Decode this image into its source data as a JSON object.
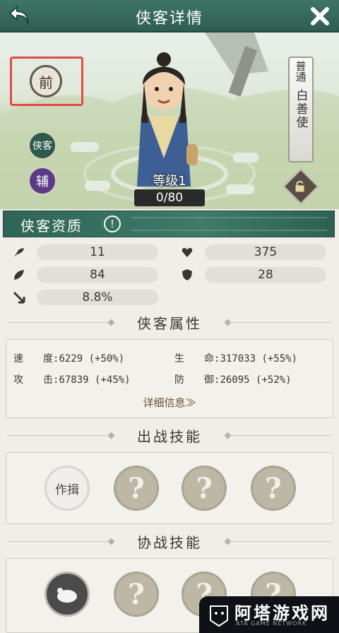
{
  "header": {
    "title": "侠客详情"
  },
  "hero": {
    "position_badge": "前",
    "role_badges": [
      "侠客",
      "辅"
    ],
    "level_text": "等级1",
    "exp_text": "0/80",
    "rarity": "普通",
    "type": "白善使"
  },
  "quality": {
    "title": "侠客资质",
    "info_mark": "!",
    "stats": [
      {
        "icon": "feather-icon",
        "value": "11"
      },
      {
        "icon": "heart-icon",
        "value": "375"
      },
      {
        "icon": "leaf-icon",
        "value": "84"
      },
      {
        "icon": "shield-icon",
        "value": "28"
      },
      {
        "icon": "arrow-icon",
        "value": "8.8%"
      }
    ]
  },
  "attributes": {
    "title": "侠客属性",
    "speed": {
      "label": "速　　度:",
      "value": "6229",
      "bonus": "(+50%)"
    },
    "life": {
      "label": "生　　命:",
      "value": "317033",
      "bonus": "(+55%)"
    },
    "attack": {
      "label": "攻　　击:",
      "value": "67839",
      "bonus": "(+45%)"
    },
    "defense": {
      "label": "防　　御:",
      "value": "26095",
      "bonus": "(+52%)"
    },
    "detail_link": "详细信息≫"
  },
  "battle_skills": {
    "title": "出战技能",
    "skills": [
      "作揖",
      "?",
      "?",
      "?"
    ]
  },
  "assist_skills": {
    "title": "协战技能",
    "skills": [
      "",
      "?",
      "?",
      "?"
    ]
  },
  "watermark": {
    "name": "阿塔游戏网",
    "sub": "ATA GAME NETWORK"
  },
  "colors": {
    "header": "#3f7566",
    "accent_red": "#e34a43",
    "pill": "#e2e0d6"
  }
}
